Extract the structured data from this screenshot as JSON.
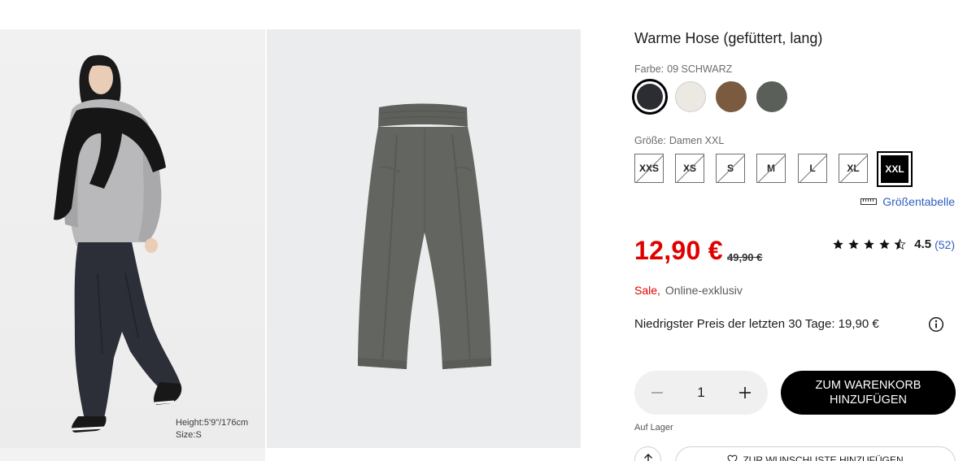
{
  "gallery": {
    "caption_height": "Height:5'9\"/176cm",
    "caption_size": "Size:S"
  },
  "product": {
    "title": "Warme Hose (gefüttert, lang)",
    "color_label": "Farbe:",
    "color_value": "09 SCHWARZ",
    "colors": [
      {
        "name": "black",
        "hex": "#2b2d33"
      },
      {
        "name": "off-white",
        "hex": "#ece9e3"
      },
      {
        "name": "brown",
        "hex": "#7a5b3f"
      },
      {
        "name": "olive",
        "hex": "#5b5f5a"
      }
    ],
    "size_label": "Größe:",
    "size_value": "Damen XXL",
    "sizes": [
      "XXS",
      "XS",
      "S",
      "M",
      "L",
      "XL",
      "XXL"
    ],
    "selected_size": "XXL",
    "size_chart_link": "Größentabelle",
    "price": "12,90 €",
    "old_price": "49,90 €",
    "rating_value": "4.5",
    "rating_count": "(52)",
    "rating_stars": 4.5,
    "badge_sale": "Sale,",
    "badge_online": "Online-exklusiv",
    "lowest_price": "Niedrigster Preis der letzten 30 Tage: 19,90 €",
    "quantity": "1",
    "add_to_cart": "ZUM WARENKORB HINZUFÜGEN",
    "stock": "Auf Lager",
    "wishlist": "ZUR WUNSCHLISTE HINZUFÜGEN"
  },
  "colors": {
    "sale_red": "#e00000",
    "link_blue": "#2f5fbf",
    "button_black": "#000000"
  }
}
